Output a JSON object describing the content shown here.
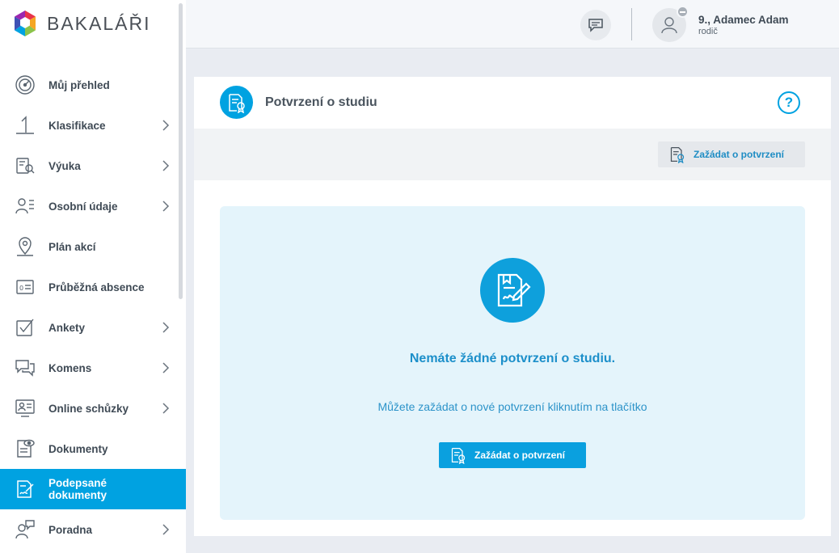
{
  "brand": {
    "name": "BAKALÁŘI",
    "colors": [
      "#e8334a",
      "#f5a623",
      "#00a2e1",
      "#8bc34a"
    ]
  },
  "sidebar": {
    "items": [
      {
        "label": "Můj přehled",
        "icon": "dashboard-gauge-icon",
        "has_submenu": false,
        "active": false
      },
      {
        "label": "Klasifikace",
        "icon": "grade-one-icon",
        "has_submenu": true,
        "active": false
      },
      {
        "label": "Výuka",
        "icon": "book-search-icon",
        "has_submenu": true,
        "active": false
      },
      {
        "label": "Osobní údaje",
        "icon": "person-card-icon",
        "has_submenu": true,
        "active": false
      },
      {
        "label": "Plán akcí",
        "icon": "map-pin-icon",
        "has_submenu": false,
        "active": false
      },
      {
        "label": "Průběžná absence",
        "icon": "absence-card-icon",
        "has_submenu": false,
        "active": false
      },
      {
        "label": "Ankety",
        "icon": "checkbox-icon",
        "has_submenu": true,
        "active": false
      },
      {
        "label": "Komens",
        "icon": "chat-bubbles-icon",
        "has_submenu": true,
        "active": false
      },
      {
        "label": "Online schůzky",
        "icon": "video-meeting-icon",
        "has_submenu": true,
        "active": false
      },
      {
        "label": "Dokumenty",
        "icon": "document-eye-icon",
        "has_submenu": false,
        "active": false
      },
      {
        "label": "Podepsané dokumenty",
        "icon": "signed-document-icon",
        "has_submenu": false,
        "active": true
      },
      {
        "label": "Poradna",
        "icon": "counseling-icon",
        "has_submenu": true,
        "active": false
      }
    ]
  },
  "header": {
    "user_name": "9., Adamec Adam",
    "user_role": "rodič"
  },
  "page": {
    "title": "Potvrzení o studiu",
    "help_label": "?",
    "toolbar_button": "Zažádat o potvrzení",
    "empty_title": "Nemáte žádné potvrzení o studiu.",
    "empty_subtitle": "Můžete zažádat o nové potvrzení kliknutím na tlačítko",
    "primary_button": "Zažádat o potvrzení"
  },
  "colors": {
    "accent": "#00a2e1",
    "empty_bg": "#e4f4fb",
    "text_blue": "#1c8fca"
  }
}
